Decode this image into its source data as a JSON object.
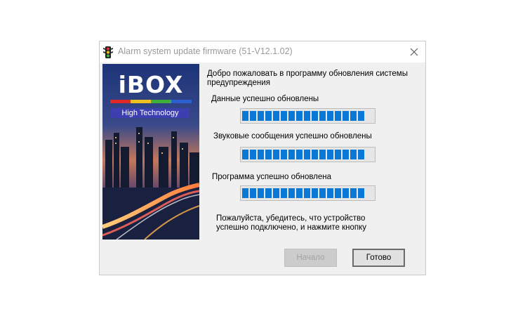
{
  "window": {
    "title": "Alarm system update firmware (51-V12.1.02)",
    "icon": "traffic-light-icon",
    "close_icon": "close-icon"
  },
  "banner": {
    "logo_text": "iBOX",
    "tagline": "High Technology",
    "stripe_colors": [
      "#e02a2a",
      "#f0c020",
      "#3fae3a",
      "#2c5fd0"
    ]
  },
  "content": {
    "welcome": "Добро пожаловать в программу обновления системы предупреждения",
    "tasks": [
      {
        "label": "Данные успешно обновлены",
        "progress": 1.0
      },
      {
        "label": "Звуковые сообщения успешно обновлены",
        "progress": 1.0
      },
      {
        "label": "Программа успешно обновлена",
        "progress": 1.0
      }
    ],
    "note": "Пожалуйста, убедитесь, что устройство успешно подключено, и нажмите кнопку"
  },
  "buttons": {
    "start_label": "Начало",
    "start_enabled": false,
    "done_label": "Готово"
  },
  "colors": {
    "progress_fill": "#0a78d7"
  }
}
